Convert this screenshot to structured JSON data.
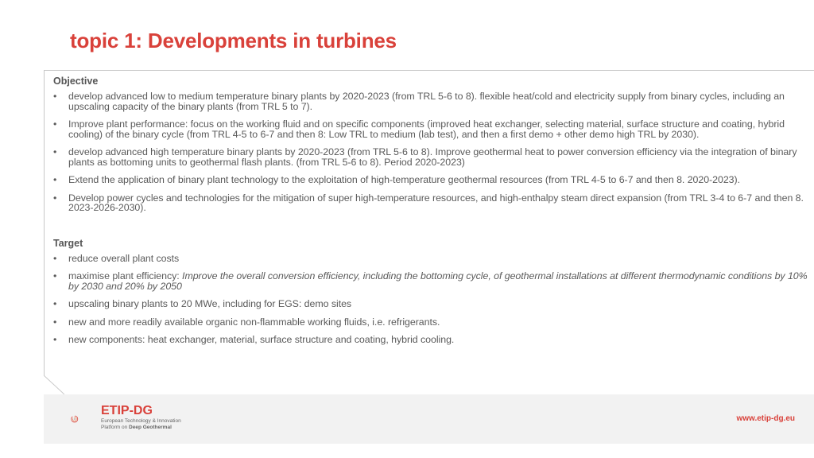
{
  "title": "topic 1: Developments in turbines",
  "objective": {
    "heading": "Objective",
    "items": [
      "develop advanced low to medium temperature binary plants  by 2020-2023 (from TRL 5-6 to 8).  flexible heat/cold and electricity supply from binary cycles, including an upscaling capacity of the binary plants (from TRL 5 to 7).",
      "Improve plant performance: focus on the working fluid and on specific components (improved heat exchanger, selecting material, surface structure and coating, hybrid cooling) of the binary cycle (from TRL 4-5 to 6-7 and then 8: Low TRL to medium (lab test), and then a first demo + other demo high TRL by 2030).",
      "develop advanced high temperature binary plants  by 2020-2023 (from TRL 5-6 to 8). Improve geothermal heat to power conversion efficiency via the integration of binary plants as bottoming units to geothermal flash plants. (from TRL 5-6 to 8). Period 2020-2023)",
      "Extend the application of binary plant technology to the exploitation of high-temperature geothermal resources (from TRL 4-5 to 6-7 and then 8. 2020-2023).",
      "Develop power cycles and technologies for the mitigation of super high-temperature resources, and high-enthalpy steam direct expansion (from TRL 3-4 to 6-7 and then 8. 2023-2026-2030)."
    ]
  },
  "target": {
    "heading": "Target",
    "item1": "reduce overall plant costs",
    "item2_prefix": "maximise plant efficiency: ",
    "item2_italic": "Improve the overall conversion efficiency, including the bottoming cycle, of geothermal installations at different thermodynamic conditions by 10% by 2030 and 20% by 2050",
    "item3": "upscaling binary plants to 20 MWe, including for EGS: demo sites",
    "item4": "new and more readily available organic non-flammable working fluids, i.e. refrigerants.",
    "item5": "new components: heat exchanger, material, surface structure and coating, hybrid cooling."
  },
  "footer": {
    "logo_name": "ETIP-DG",
    "logo_line1": "European Technology & Innovation",
    "logo_line2_prefix": "Platform on ",
    "logo_line2_bold": "Deep Geothermal",
    "url": "www.etip-dg.eu"
  },
  "colors": {
    "accent": "#d9413a",
    "text": "#555555",
    "footer_bg": "#f2f2f2"
  }
}
